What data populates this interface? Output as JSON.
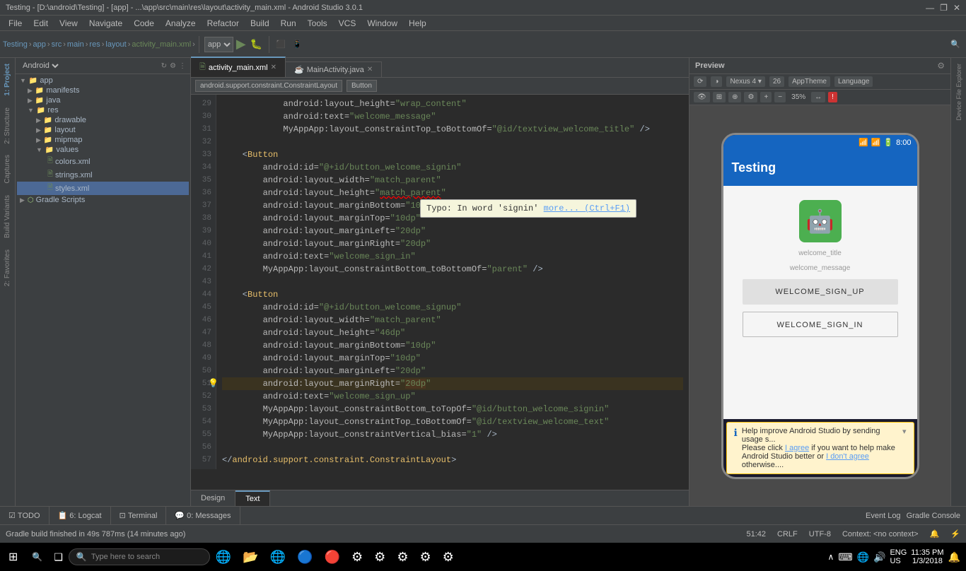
{
  "titleBar": {
    "title": "Testing - [D:\\android\\Testing] - [app] - ...\\app\\src\\main\\res\\layout\\activity_main.xml - Android Studio 3.0.1",
    "minimize": "—",
    "restore": "❐",
    "close": "✕"
  },
  "menuBar": {
    "items": [
      "File",
      "Edit",
      "View",
      "Navigate",
      "Code",
      "Analyze",
      "Refactor",
      "Build",
      "Run",
      "Tools",
      "VCS",
      "Window",
      "Help"
    ]
  },
  "breadcrumb": {
    "items": [
      "Testing",
      "app",
      "src",
      "main",
      "res",
      "layout",
      "activity_main.xml"
    ]
  },
  "projectPanel": {
    "title": "Android",
    "tree": [
      {
        "id": "app",
        "label": "app",
        "level": 0,
        "type": "folder",
        "expanded": true
      },
      {
        "id": "manifests",
        "label": "manifests",
        "level": 1,
        "type": "folder",
        "expanded": false
      },
      {
        "id": "java",
        "label": "java",
        "level": 1,
        "type": "folder",
        "expanded": false
      },
      {
        "id": "res",
        "label": "res",
        "level": 1,
        "type": "folder",
        "expanded": true
      },
      {
        "id": "drawable",
        "label": "drawable",
        "level": 2,
        "type": "folder",
        "expanded": false
      },
      {
        "id": "layout",
        "label": "layout",
        "level": 2,
        "type": "folder",
        "expanded": false
      },
      {
        "id": "mipmap",
        "label": "mipmap",
        "level": 2,
        "type": "folder",
        "expanded": false
      },
      {
        "id": "values",
        "label": "values",
        "level": 2,
        "type": "folder",
        "expanded": true
      },
      {
        "id": "colors",
        "label": "colors.xml",
        "level": 3,
        "type": "xml",
        "expanded": false
      },
      {
        "id": "strings",
        "label": "strings.xml",
        "level": 3,
        "type": "xml",
        "expanded": false
      },
      {
        "id": "styles",
        "label": "styles.xml",
        "level": 3,
        "type": "xml",
        "expanded": false,
        "selected": true
      },
      {
        "id": "gradle-scripts",
        "label": "Gradle Scripts",
        "level": 0,
        "type": "gradle",
        "expanded": false
      }
    ]
  },
  "tabs": [
    {
      "id": "activity_main",
      "label": "activity_main.xml",
      "active": true,
      "icon": "xml"
    },
    {
      "id": "mainactivity",
      "label": "MainActivity.java",
      "active": false,
      "icon": "java"
    }
  ],
  "codeLines": [
    {
      "num": "29",
      "content": "            android:layout_height=\"wrap_content\"",
      "highlight": false
    },
    {
      "num": "30",
      "content": "            android:text=\"welcome_message\"",
      "highlight": false
    },
    {
      "num": "31",
      "content": "            MyAppApp:layout_constraintTop_toBottomOf=\"@id/textview_welcome_title\" />",
      "highlight": false
    },
    {
      "num": "32",
      "content": "",
      "highlight": false
    },
    {
      "num": "33",
      "content": "    <Button",
      "highlight": false
    },
    {
      "num": "34",
      "content": "        android:id=\"@+id/button_welcome_signin\"",
      "highlight": false
    },
    {
      "num": "35",
      "content": "        android:layout_width=\"match_parent\"",
      "highlight": false
    },
    {
      "num": "36",
      "content": "        android:layout_height=\"                             \"",
      "highlight": false,
      "tooltip": true
    },
    {
      "num": "37",
      "content": "        android:layout_marginBottom=\"10dp\"",
      "highlight": false
    },
    {
      "num": "38",
      "content": "        android:layout_marginTop=\"10dp\"",
      "highlight": false
    },
    {
      "num": "39",
      "content": "        android:layout_marginLeft=\"20dp\"",
      "highlight": false
    },
    {
      "num": "40",
      "content": "        android:layout_marginRight=\"20dp\"",
      "highlight": false
    },
    {
      "num": "41",
      "content": "        android:text=\"welcome_sign_in\"",
      "highlight": false
    },
    {
      "num": "42",
      "content": "        MyAppApp:layout_constraintBottom_toBottomOf=\"parent\" />",
      "highlight": false
    },
    {
      "num": "43",
      "content": "",
      "highlight": false
    },
    {
      "num": "44",
      "content": "    <Button",
      "highlight": false
    },
    {
      "num": "45",
      "content": "        android:id=\"@+id/button_welcome_signup\"",
      "highlight": false
    },
    {
      "num": "46",
      "content": "        android:layout_width=\"match_parent\"",
      "highlight": false
    },
    {
      "num": "47",
      "content": "        android:layout_height=\"46dp\"",
      "highlight": false
    },
    {
      "num": "48",
      "content": "        android:layout_marginBottom=\"10dp\"",
      "highlight": false
    },
    {
      "num": "49",
      "content": "        android:layout_marginTop=\"10dp\"",
      "highlight": false
    },
    {
      "num": "50",
      "content": "        android:layout_marginLeft=\"20dp\"",
      "highlight": false
    },
    {
      "num": "51",
      "content": "        android:layout_marginRight=\"20dp\"",
      "highlight": true,
      "warning": true
    },
    {
      "num": "52",
      "content": "        android:text=\"welcome_sign_up\"",
      "highlight": false
    },
    {
      "num": "53",
      "content": "        MyAppApp:layout_constraintBottom_toTopOf=\"@id/button_welcome_signin\"",
      "highlight": false
    },
    {
      "num": "54",
      "content": "        MyAppApp:layout_constraintTop_toBottomOf=\"@id/textview_welcome_text\"",
      "highlight": false
    },
    {
      "num": "55",
      "content": "        MyAppApp:layout_constraintVertical_bias=\"1\" />",
      "highlight": false
    },
    {
      "num": "56",
      "content": "",
      "highlight": false
    },
    {
      "num": "57",
      "content": "</android.support.constraint.ConstraintLayout>",
      "highlight": false
    }
  ],
  "tooltip": {
    "text": "Typo: In word 'signin'",
    "link": "more... (Ctrl+F1)"
  },
  "topBarButtons": {
    "constraintLayout": "android.support.constraint.ConstraintLayout",
    "button": "Button"
  },
  "preview": {
    "title": "Preview",
    "deviceName": "Nexus 4",
    "apiLevel": "26",
    "theme": "AppTheme",
    "language": "Language",
    "zoom": "35%",
    "appTitle": "Testing",
    "welcomeTitle": "welcome_title",
    "welcomeMessage": "welcome_message",
    "signupBtn": "WELCOME_SIGN_UP",
    "signinBtn": "WELCOME_SIGN_IN"
  },
  "helpBanner": {
    "text": "Help improve Android Studio by sending usage s...",
    "line2": "Please click I agree if you want to help make",
    "line3": "Android Studio better or I don't agree otherwise....",
    "agreeLink": "I agree",
    "disagreeLink": "I don't agree"
  },
  "bottomTabs": [
    {
      "id": "design",
      "label": "Design",
      "active": false
    },
    {
      "id": "text",
      "label": "Text",
      "active": true
    }
  ],
  "bottomPanelTabs": [
    {
      "id": "todo",
      "label": "TODO"
    },
    {
      "id": "logcat",
      "label": "6: Logcat"
    },
    {
      "id": "terminal",
      "label": "Terminal"
    },
    {
      "id": "messages",
      "label": "0: Messages"
    }
  ],
  "statusBar": {
    "buildMsg": "Gradle build finished in 49s 787ms (14 minutes ago)",
    "position": "51:42",
    "lineEnding": "CRLF",
    "encoding": "UTF-8",
    "context": "Context: <no context>",
    "eventLog": "Event Log",
    "gradleConsole": "Gradle Console"
  },
  "taskbar": {
    "searchPlaceholder": "Type here to search",
    "time": "11:35 PM",
    "date": "1/3/2018",
    "language": "ENG\nUS"
  },
  "sidebarLeft": [
    "1: Project",
    "2: Structure",
    "Captures",
    "Build Variants",
    "2: Favorites"
  ],
  "sidebarRight": [
    "Device File Explorer"
  ]
}
